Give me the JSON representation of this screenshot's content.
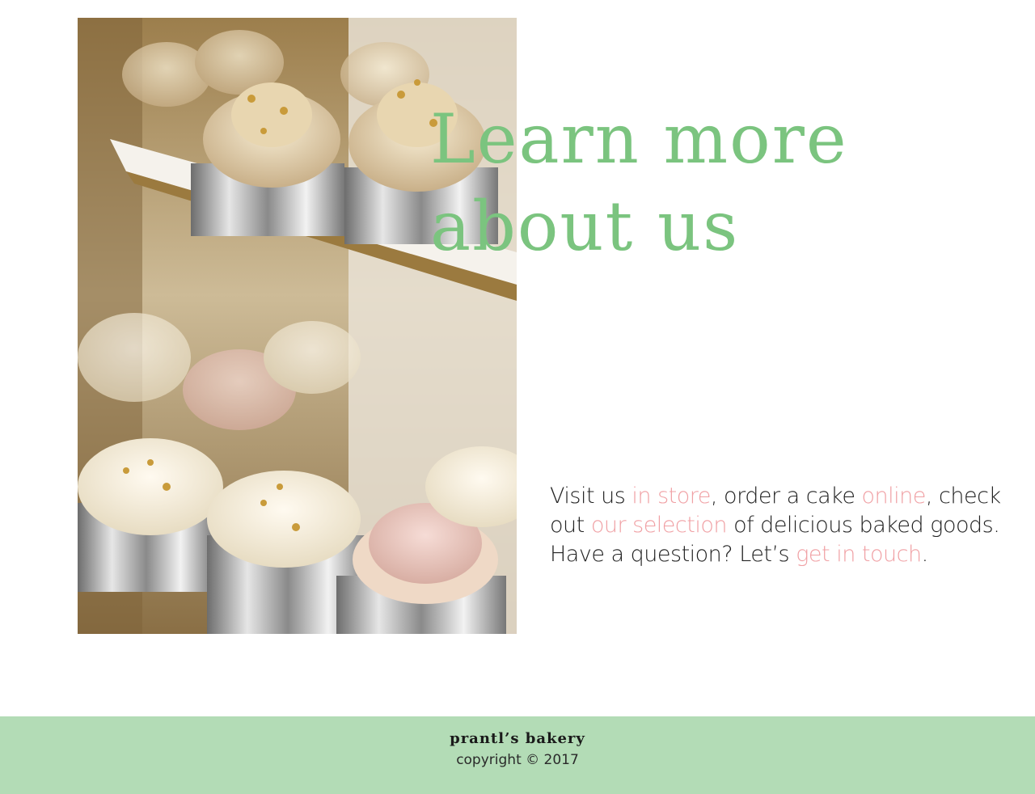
{
  "hero": {
    "heading_line1": "Learn more",
    "heading_line2": "about us",
    "image_alt": "cupcakes on a tiered stand"
  },
  "intro": {
    "t1": "Visit us ",
    "link_store": "in store",
    "t2": ", order a cake ",
    "link_online": "online",
    "t3": ", check out ",
    "link_selection": "our selection",
    "t4": " of delicious baked goods. Have a question? Let’s ",
    "link_contact": "get in touch",
    "t5": "."
  },
  "footer": {
    "brand": "prantl’s bakery",
    "copyright": "copyright © 2017"
  },
  "colors": {
    "heading": "#7bc47f",
    "link": "#f0a0a4",
    "footer_bg": "#b3dcb6"
  }
}
